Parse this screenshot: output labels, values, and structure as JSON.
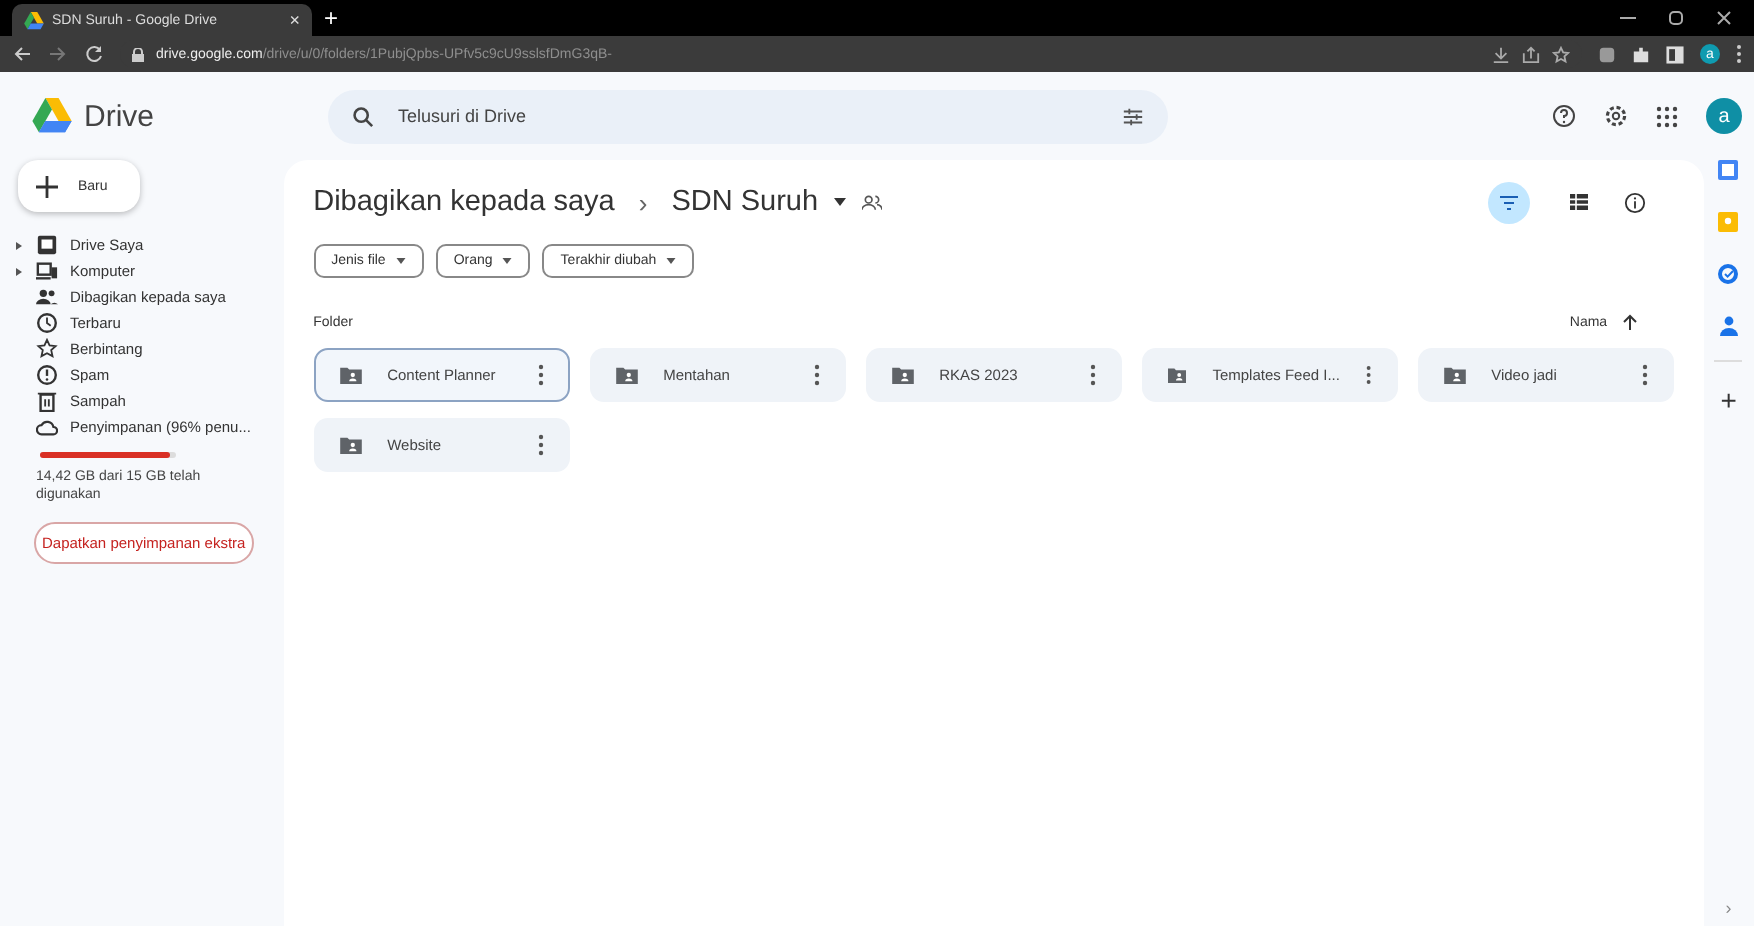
{
  "browser": {
    "tab": {
      "title": "SDN Suruh - Google Drive",
      "close": "×"
    },
    "new_tab": "+",
    "url": {
      "host": "drive.google.com",
      "path": "/drive/u/0/folders/1PubjQpbs-UPfv5c9cU9sslsfDmG3qB-"
    },
    "profile": "a"
  },
  "app": {
    "name": "Drive",
    "search": {
      "placeholder": "Telusuri di Drive"
    },
    "account": "a"
  },
  "new_button": {
    "label": "Baru"
  },
  "sidebar": {
    "items": [
      {
        "label": "Drive Saya",
        "expandable": true
      },
      {
        "label": "Komputer",
        "expandable": true
      },
      {
        "label": "Dibagikan kepada saya",
        "expandable": false
      },
      {
        "label": "Terbaru",
        "expandable": false
      },
      {
        "label": "Berbintang",
        "expandable": false
      },
      {
        "label": "Spam",
        "expandable": false
      },
      {
        "label": "Sampah",
        "expandable": false
      },
      {
        "label": "Penyimpanan (96% penu...",
        "expandable": false
      }
    ],
    "storage": {
      "level": 0.96,
      "text": "14,42 GB dari 15 GB telah digunakan"
    },
    "upgrade_button": "Dapatkan penyimpanan ekstra"
  },
  "breadcrumb": {
    "parent": "Dibagikan kepada saya",
    "separator": "›",
    "current": "SDN Suruh"
  },
  "filters": [
    {
      "label": "Jenis file"
    },
    {
      "label": "Orang"
    },
    {
      "label": "Terakhir diubah"
    }
  ],
  "section": {
    "title": "Folder",
    "sort": "Nama"
  },
  "folders": [
    {
      "name": "Content Planner",
      "selected": true
    },
    {
      "name": "Mentahan",
      "selected": false
    },
    {
      "name": "RKAS 2023",
      "selected": false
    },
    {
      "name": "Templates Feed I...",
      "selected": false
    },
    {
      "name": "Video jadi",
      "selected": false
    },
    {
      "name": "Website",
      "selected": false
    }
  ],
  "side_panel": {
    "add": "+",
    "collapse": "›"
  }
}
